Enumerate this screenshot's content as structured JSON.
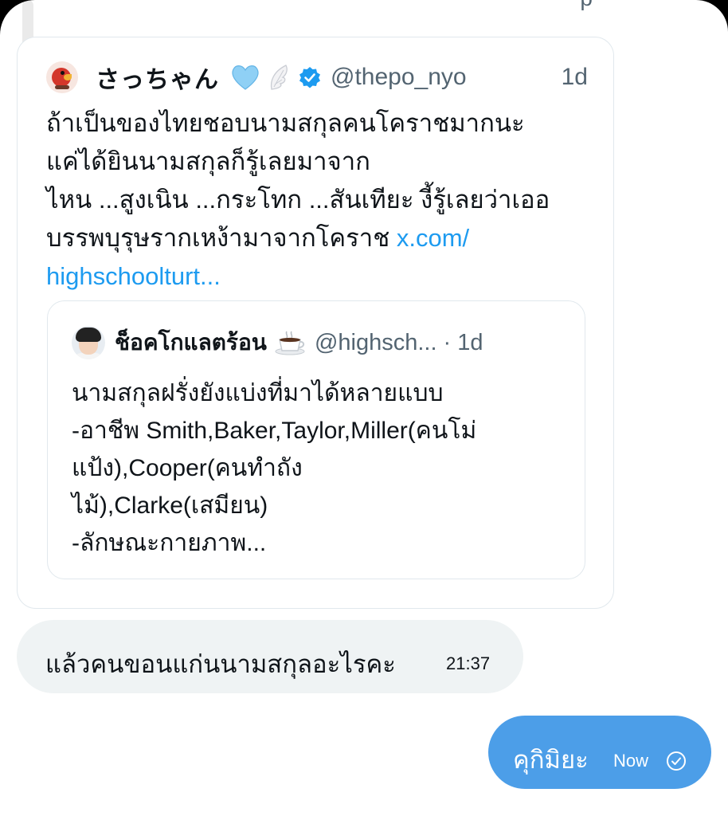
{
  "top_remnant": "p",
  "quoted_tweet": {
    "display_name": "さっちゃん",
    "badge_icons": [
      "heart-icon",
      "wing-icon",
      "verified-icon"
    ],
    "handle": "@thepo_nyo",
    "time": "1d",
    "body_lines": [
      "ถ้าเป็นของไทยชอบนามสกุลคนโคราชมากนะ",
      "แค่ได้ยินนามสกุลก็รู้เลยมาจาก",
      "ไหน ...สูงเนิน ...กระโทก ...สันเทียะ งี้รู้เลยว่าเออ",
      "บรรพบุรุษรากเหง้ามาจากโคราช"
    ],
    "link_part1": "x.com/",
    "link_part2": "highschoolturt...",
    "nested": {
      "display_name": "ช็อคโกแลตร้อน",
      "emoji_icon": "coffee-icon",
      "handle": "@highsch...",
      "time": "· 1d",
      "body_lines": [
        "นามสกุลฝรั่งยังแบ่งที่มาได้หลายแบบ",
        "-อาชีพ Smith,Baker,Taylor,Miller(คนโม่",
        "แป้ง),Cooper(คนทำถัง",
        "ไม้),Clarke(เสมียน)",
        "-ลักษณะกายภาพ..."
      ]
    }
  },
  "received_message": {
    "text": "แล้วคนขอนแก่นนามสกุลอะไรคะ",
    "time": "21:37"
  },
  "sent_message": {
    "text": "คุกิมิยะ",
    "time": "Now",
    "status_icon": "check-circle-icon"
  },
  "colors": {
    "link": "#1d9bf0",
    "sent_bubble": "#4c9ee8",
    "received_bubble": "#eff3f4",
    "verified": "#1d9bf0"
  }
}
